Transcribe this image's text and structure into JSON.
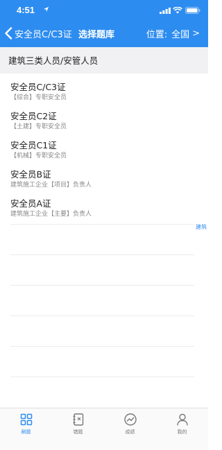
{
  "status_bar": {
    "time": "4:51"
  },
  "nav": {
    "back_label": "安全员C/C3证",
    "title": "选择题库",
    "location_label": "位置:",
    "location_value": "全国",
    "location_chevron": ">"
  },
  "category": {
    "label": "建筑三类人员/安管人员"
  },
  "items": [
    {
      "title": "安全员C/C3证",
      "subtitle": "【综合】专职安全员"
    },
    {
      "title": "安全员C2证",
      "subtitle": "【土建】专职安全员"
    },
    {
      "title": "安全员C1证",
      "subtitle": "【机械】专职安全员"
    },
    {
      "title": "安全员B证",
      "subtitle": "建筑施工企业【项目】负责人"
    },
    {
      "title": "安全员A证",
      "subtitle": "建筑施工企业【主要】负责人"
    }
  ],
  "side_tag": "建筑",
  "tabs": [
    {
      "label": "刷题",
      "icon": "grid-icon",
      "active": true
    },
    {
      "label": "错题",
      "icon": "notebook-icon",
      "active": false
    },
    {
      "label": "成绩",
      "icon": "chart-icon",
      "active": false
    },
    {
      "label": "我的",
      "icon": "person-icon",
      "active": false
    }
  ],
  "colors": {
    "primary": "#2d8cf0",
    "category_bg": "#f1f1f3",
    "subtitle": "#888888"
  }
}
